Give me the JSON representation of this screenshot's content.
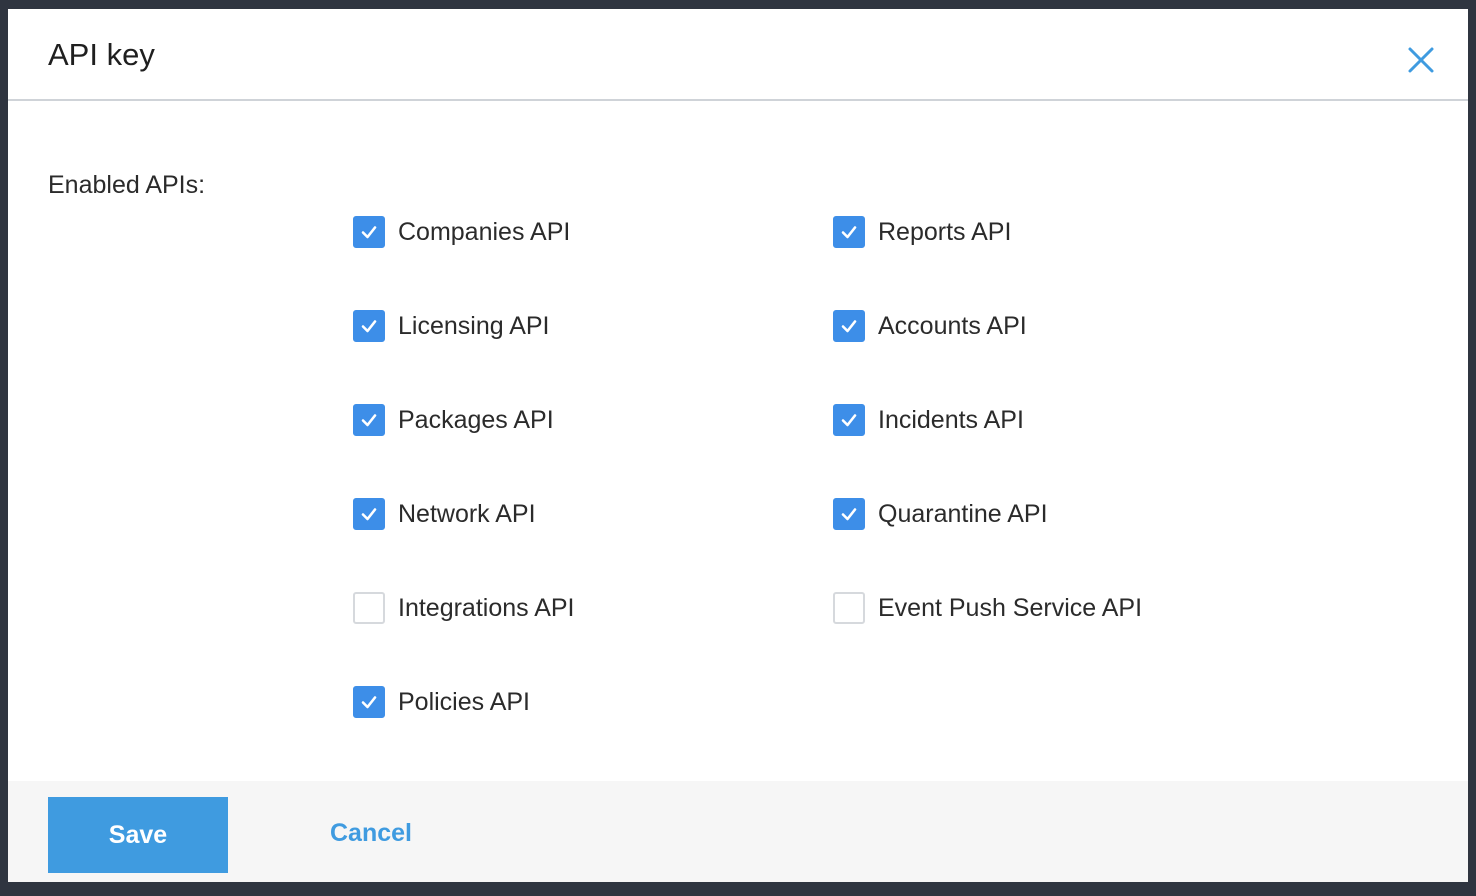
{
  "dialog": {
    "title": "API key",
    "close_icon": "close-icon"
  },
  "enabled_apis": {
    "label": "Enabled APIs:",
    "items": [
      {
        "label": "Companies API",
        "checked": true
      },
      {
        "label": "Reports API",
        "checked": true
      },
      {
        "label": "Licensing API",
        "checked": true
      },
      {
        "label": "Accounts API",
        "checked": true
      },
      {
        "label": "Packages API",
        "checked": true
      },
      {
        "label": "Incidents API",
        "checked": true
      },
      {
        "label": "Network API",
        "checked": true
      },
      {
        "label": "Quarantine API",
        "checked": true
      },
      {
        "label": "Integrations API",
        "checked": false
      },
      {
        "label": "Event Push Service API",
        "checked": false
      },
      {
        "label": "Policies API",
        "checked": true
      }
    ]
  },
  "footer": {
    "save_label": "Save",
    "cancel_label": "Cancel"
  },
  "colors": {
    "accent": "#3f9be0",
    "checkbox_checked": "#3d8ee8"
  }
}
